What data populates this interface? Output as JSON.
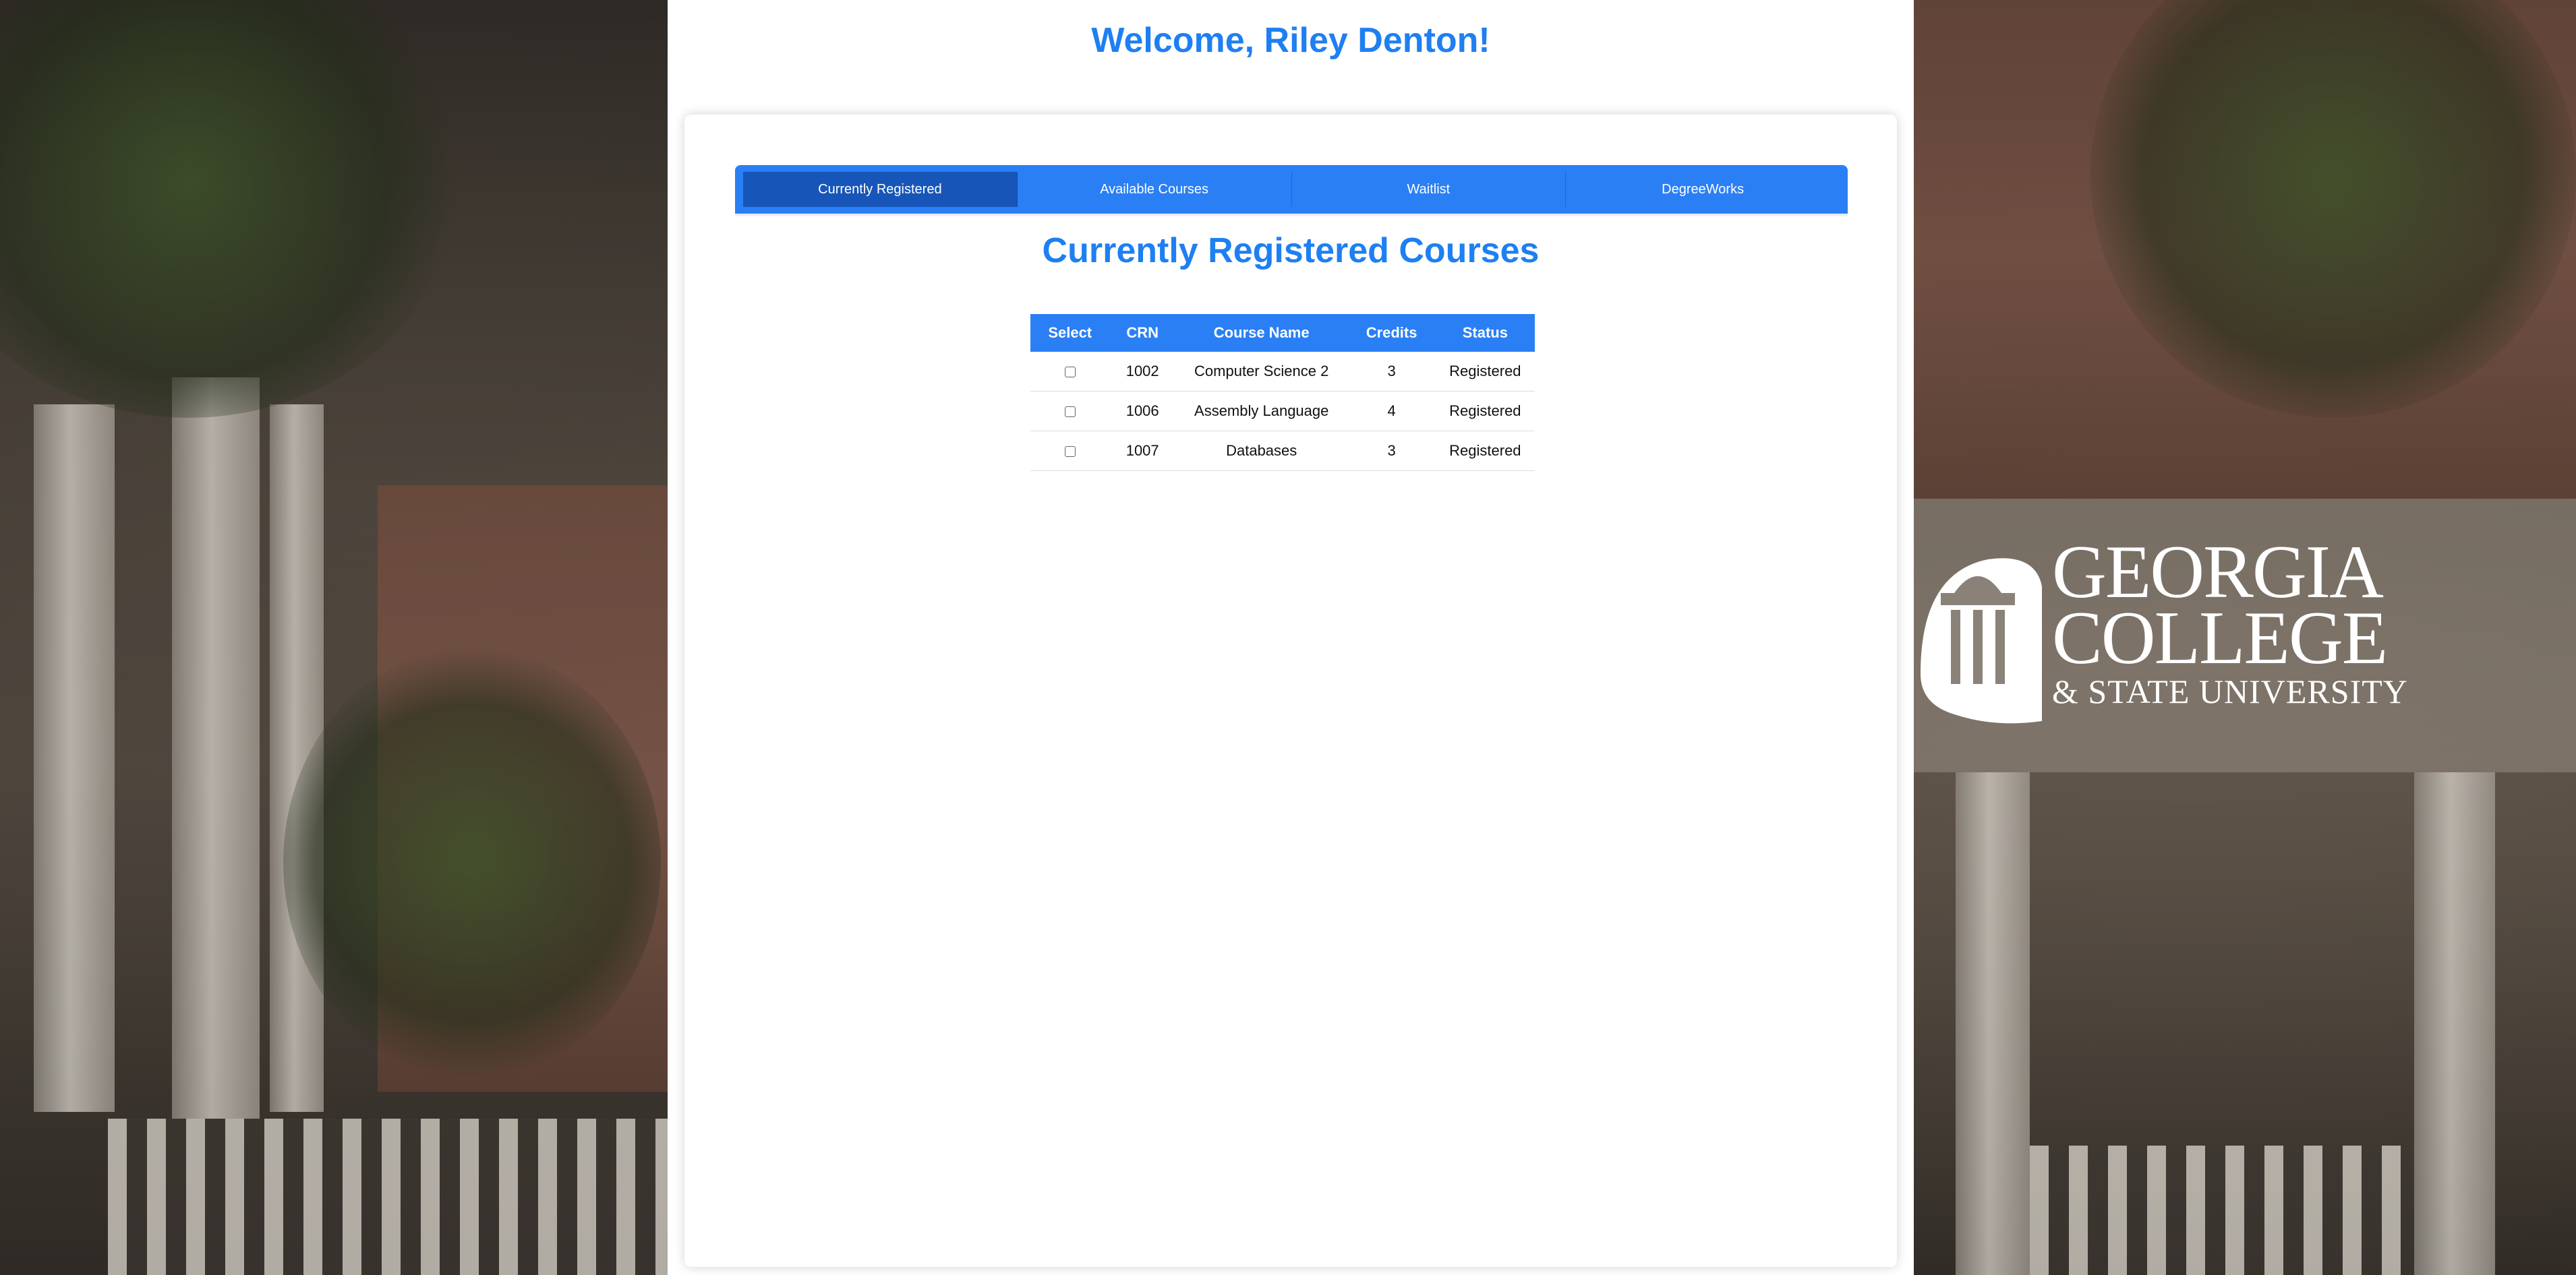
{
  "welcome": "Welcome, Riley Denton!",
  "tabs": [
    {
      "label": "Currently Registered",
      "active": true
    },
    {
      "label": "Available Courses",
      "active": false
    },
    {
      "label": "Waitlist",
      "active": false
    },
    {
      "label": "DegreeWorks",
      "active": false
    }
  ],
  "section_title": "Currently Registered Courses",
  "table": {
    "headers": [
      "Select",
      "CRN",
      "Course Name",
      "Credits",
      "Status"
    ],
    "rows": [
      {
        "crn": "1002",
        "course": "Computer Science 2",
        "credits": "3",
        "status": "Registered",
        "selected": false
      },
      {
        "crn": "1006",
        "course": "Assembly Language",
        "credits": "4",
        "status": "Registered",
        "selected": false
      },
      {
        "crn": "1007",
        "course": "Databases",
        "credits": "3",
        "status": "Registered",
        "selected": false
      }
    ]
  },
  "logo": {
    "line1": "GEORGIA",
    "line2": "COLLEGE",
    "line3": "& STATE UNIVERSITY"
  },
  "colors": {
    "accent": "#1e7ff2",
    "tab_bar": "#2a7ff5",
    "tab_active": "#1756b8"
  }
}
